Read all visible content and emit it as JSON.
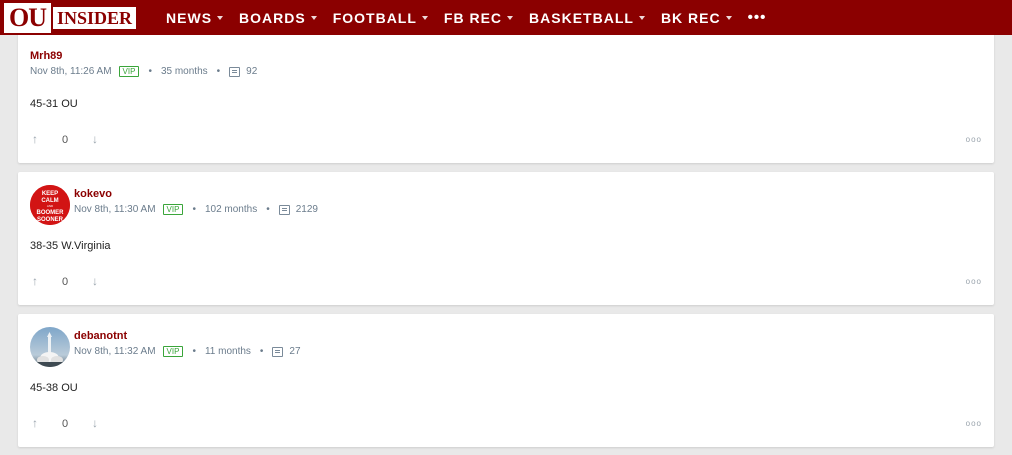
{
  "brand": {
    "ou": "OU",
    "insider": "INSIDER"
  },
  "nav": {
    "items": [
      {
        "label": "NEWS",
        "dropdown": true
      },
      {
        "label": "BOARDS",
        "dropdown": true
      },
      {
        "label": "FOOTBALL",
        "dropdown": true
      },
      {
        "label": "FB REC",
        "dropdown": true
      },
      {
        "label": "BASKETBALL",
        "dropdown": true
      },
      {
        "label": "BK REC",
        "dropdown": true
      }
    ],
    "more": "•••"
  },
  "posts": [
    {
      "username": "Mrh89",
      "time": "Nov 8th, 11:26 AM",
      "badge": "VIP",
      "tenure": "35 months",
      "comments": "92",
      "body": "45-31 OU",
      "votes": "0",
      "avatar": "none"
    },
    {
      "username": "kokevo",
      "time": "Nov 8th, 11:30 AM",
      "badge": "VIP",
      "tenure": "102 months",
      "comments": "2129",
      "body": "38-35 W.Virginia",
      "votes": "0",
      "avatar": "keep-calm-boomer-sooner",
      "avatar_text": [
        "KEEP",
        "CALM",
        "AND",
        "BOOMER",
        "SOONER"
      ]
    },
    {
      "username": "debanotnt",
      "time": "Nov 8th, 11:32 AM",
      "badge": "VIP",
      "tenure": "11 months",
      "comments": "27",
      "body": "45-38 OU",
      "votes": "0",
      "avatar": "rocket-launch-photo"
    }
  ],
  "icons": {
    "upvote": "↑",
    "downvote": "↓",
    "options": "ooo",
    "separator": "•"
  },
  "colors": {
    "brand_red": "#8b0000",
    "vip_green": "#3aa53a",
    "meta_gray": "#6b7c8c"
  }
}
